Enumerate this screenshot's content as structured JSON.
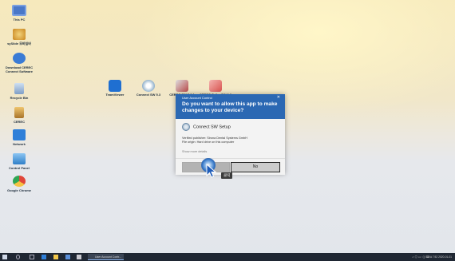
{
  "desktop": {
    "left_icons": [
      {
        "name": "this-pc-icon",
        "label": "This PC",
        "color": "#4a78c8"
      },
      {
        "name": "spiral-folder-icon",
        "label": "sySlide 모바일바",
        "color": "#e4a032"
      },
      {
        "name": "download-icon",
        "label": "Download CEREC Connect Software",
        "color": "#3a7bd5"
      },
      {
        "name": "recycle-bin-icon",
        "label": "Recycle Bin",
        "color": "#8fb1d8"
      },
      {
        "name": "cerec-icon",
        "label": "CEREC",
        "color": "#d9a246"
      },
      {
        "name": "network-icon",
        "label": "Network",
        "color": "#2f7fd8"
      },
      {
        "name": "control-panel-icon",
        "label": "Control Panel",
        "color": "#4fa1e0"
      },
      {
        "name": "chrome-icon",
        "label": "Google Chrome",
        "color": "#e0463a"
      }
    ],
    "center_icons": [
      {
        "name": "teamviewer-icon",
        "label": "TeamViewer",
        "color": "#1f6fd1"
      },
      {
        "name": "connect-sw-icon",
        "label": "Connect SW 5.3",
        "color": "#7aa0c0"
      },
      {
        "name": "cerec-sw-icon",
        "label": "CEREC SW 5.0.1",
        "color": "#b84a4a"
      },
      {
        "name": "cerec-ortho-icon",
        "label": "CEREC Ortho SW 2.0",
        "color": "#d9534f"
      }
    ]
  },
  "uac": {
    "title": "User Account Control",
    "close": "✕",
    "question": "Do you want to allow this app to make changes to your device?",
    "app_name": "Connect SW Setup",
    "publisher": "Verified publisher: Sirona Dental Systems GmbH",
    "origin": "File origin: Hard drive on this computer",
    "more": "Show more details",
    "yes_label": "Yes",
    "no_label": "No",
    "header_color": "#2b68b3"
  },
  "tooltip": "클릭",
  "taskbar": {
    "task_label": "User Account Contr...",
    "tray_text": "ㅅ  ◎  ▭  ◁)  ⌨  A  7:52  2020-01-01"
  }
}
